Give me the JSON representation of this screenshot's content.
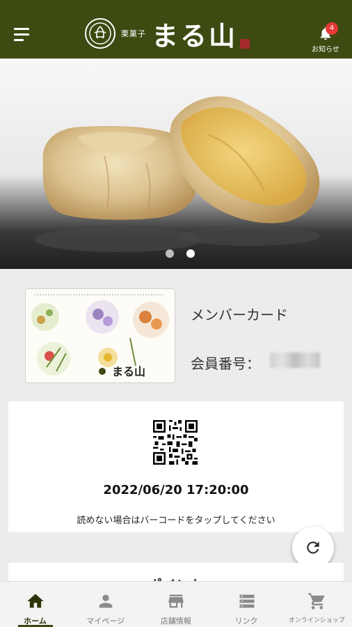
{
  "header": {
    "logo_sub": "栗菓子",
    "logo_main": "まる山",
    "notification_count": "4",
    "notification_label": "お知らせ"
  },
  "carousel": {
    "slides": 2,
    "active_index": 1
  },
  "member_card": {
    "title": "メンバーカード",
    "number_label": "会員番号："
  },
  "qr_section": {
    "datetime": "2022/06/20 17:20:00",
    "hint": "読めない場合はバーコードをタップしてください"
  },
  "points": {
    "title": "ポイント"
  },
  "tabs": [
    {
      "label": "ホーム",
      "icon": "home-icon"
    },
    {
      "label": "マイページ",
      "icon": "person-icon"
    },
    {
      "label": "店舗情報",
      "icon": "store-icon"
    },
    {
      "label": "リンク",
      "icon": "list-icon"
    },
    {
      "label": "オンラインショップ",
      "icon": "cart-icon"
    }
  ],
  "colors": {
    "brand": "#3d4a12",
    "badge": "#e53935"
  }
}
